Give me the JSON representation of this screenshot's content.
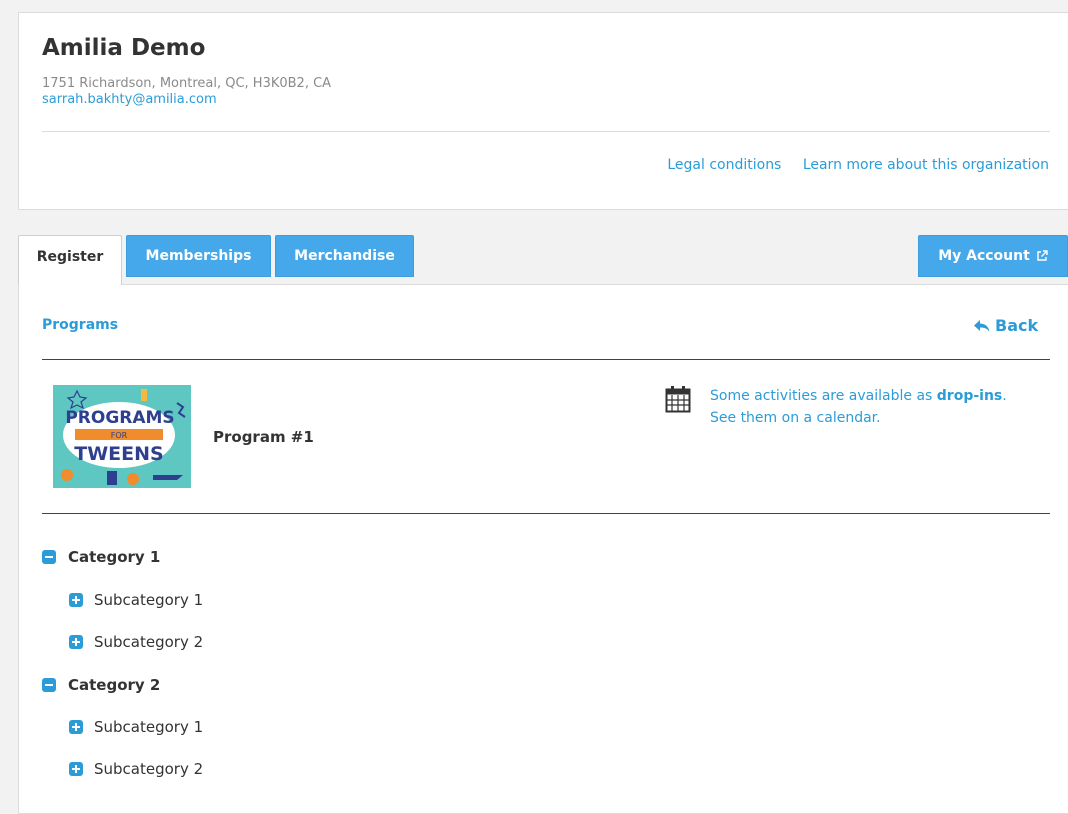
{
  "organization": {
    "name": "Amilia Demo",
    "address": "1751 Richardson, Montreal, QC, H3K0B2, CA",
    "email": "sarrah.bakhty@amilia.com",
    "links": {
      "legal": "Legal conditions",
      "learn_more": "Learn more about this organization"
    }
  },
  "tabs": {
    "register": "Register",
    "memberships": "Memberships",
    "merchandise": "Merchandise",
    "my_account": "My Account"
  },
  "content": {
    "breadcrumb": "Programs",
    "back": "Back",
    "program": {
      "title": "Program #1",
      "thumbnail_text": {
        "line1": "PROGRAMS",
        "line2": "FOR",
        "line3": "TWEENS"
      }
    },
    "dropin": {
      "prefix": "Some activities are available as ",
      "highlight": "drop-ins",
      "suffix": ".",
      "line2": "See them on a calendar."
    },
    "categories": [
      {
        "label": "Category 1",
        "subcategories": [
          "Subcategory 1",
          "Subcategory 2"
        ]
      },
      {
        "label": "Category 2",
        "subcategories": [
          "Subcategory 1",
          "Subcategory 2"
        ]
      }
    ]
  },
  "colors": {
    "accent": "#2b9cd8",
    "tab_blue": "#45a8ea",
    "background": "#f2f2f2"
  },
  "icons": {
    "back": "reply-arrow-icon",
    "calendar": "calendar-icon",
    "external": "external-link-icon",
    "collapse": "minus-box-icon",
    "expand": "plus-box-icon"
  }
}
